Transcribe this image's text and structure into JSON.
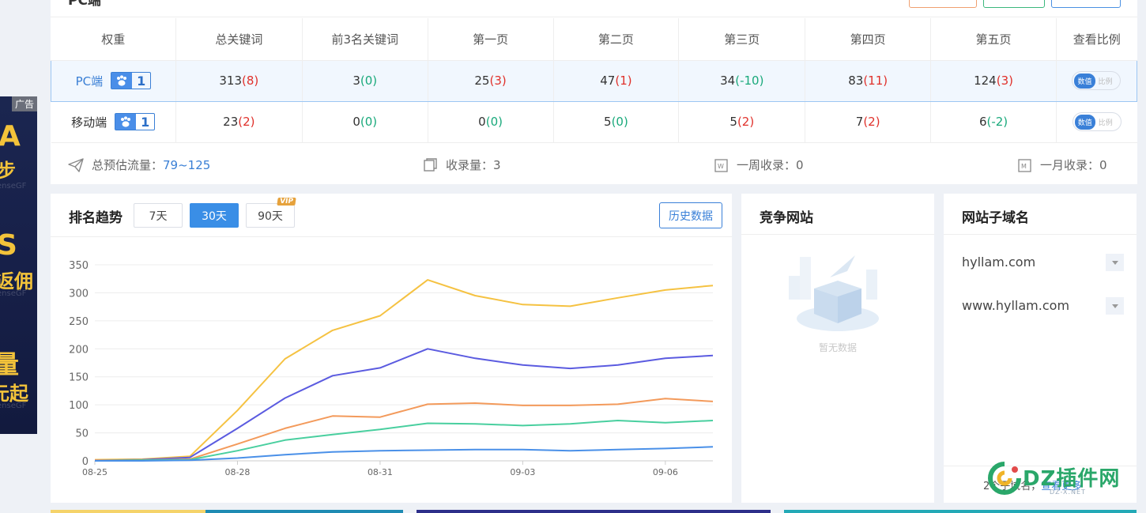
{
  "ad": {
    "tag": "广告",
    "lines": [
      "A",
      "步",
      "S",
      "返佣",
      "量",
      "元起"
    ],
    "ghost": "enseGF"
  },
  "top": {
    "title": "PC端",
    "columns": [
      "权重",
      "总关键词",
      "前3名关键词",
      "第一页",
      "第二页",
      "第三页",
      "第四页",
      "第五页",
      "查看比例"
    ],
    "rows": [
      {
        "label": "PC端",
        "badge": "1",
        "cells": [
          {
            "v": "313",
            "d": "(8)",
            "c": "red"
          },
          {
            "v": "3",
            "d": "(0)",
            "c": "green"
          },
          {
            "v": "25",
            "d": "(3)",
            "c": "red"
          },
          {
            "v": "47",
            "d": "(1)",
            "c": "red"
          },
          {
            "v": "34",
            "d": "(-10)",
            "c": "green"
          },
          {
            "v": "83",
            "d": "(11)",
            "c": "red"
          },
          {
            "v": "124",
            "d": "(3)",
            "c": "red"
          }
        ],
        "toggle_on": "数值",
        "toggle_off": "比例"
      },
      {
        "label": "移动端",
        "badge": "1",
        "cells": [
          {
            "v": "23",
            "d": "(2)",
            "c": "red"
          },
          {
            "v": "0",
            "d": "(0)",
            "c": "green"
          },
          {
            "v": "0",
            "d": "(0)",
            "c": "green"
          },
          {
            "v": "5",
            "d": "(0)",
            "c": "green"
          },
          {
            "v": "5",
            "d": "(2)",
            "c": "red"
          },
          {
            "v": "7",
            "d": "(2)",
            "c": "red"
          },
          {
            "v": "6",
            "d": "(-2)",
            "c": "green"
          }
        ],
        "toggle_on": "数值",
        "toggle_off": "比例"
      }
    ],
    "stats": {
      "traffic_label": "总预估流量：",
      "traffic_value": "79~125",
      "indexed_label": "收录量：",
      "indexed_value": "3",
      "week_label": "一周收录：",
      "week_value": "0",
      "month_label": "一月收录：",
      "month_value": "0"
    }
  },
  "trend": {
    "title": "排名趋势",
    "tabs": [
      "7天",
      "30天",
      "90天"
    ],
    "active_tab": "30天",
    "vip_badge": "VIP",
    "history_button": "历史数据"
  },
  "chart_data": {
    "type": "line",
    "x": [
      "08-25",
      "08-26",
      "08-27",
      "08-28",
      "08-29",
      "08-30",
      "08-31",
      "09-01",
      "09-02",
      "09-03",
      "09-04",
      "09-05",
      "09-06",
      "09-07"
    ],
    "tick_labels": [
      "08-25",
      "08-28",
      "08-31",
      "09-03",
      "09-06"
    ],
    "ylim": [
      0,
      350
    ],
    "yticks": [
      0,
      50,
      100,
      150,
      200,
      250,
      300,
      350
    ],
    "grid": true,
    "series": [
      {
        "color": "#f5c242",
        "values": [
          2,
          3,
          8,
          90,
          182,
          233,
          259,
          323,
          295,
          279,
          276,
          291,
          305,
          313
        ]
      },
      {
        "color": "#5b5be0",
        "values": [
          1,
          2,
          6,
          58,
          112,
          152,
          166,
          200,
          183,
          171,
          165,
          171,
          183,
          188
        ]
      },
      {
        "color": "#f39a5b",
        "values": [
          1,
          1,
          3,
          30,
          58,
          80,
          78,
          101,
          103,
          99,
          99,
          101,
          111,
          106
        ]
      },
      {
        "color": "#49cf9f",
        "values": [
          0,
          1,
          2,
          18,
          37,
          47,
          56,
          67,
          66,
          63,
          66,
          72,
          68,
          72
        ]
      },
      {
        "color": "#4a90e8",
        "values": [
          0,
          0,
          1,
          5,
          11,
          16,
          18,
          19,
          20,
          20,
          18,
          20,
          22,
          25
        ]
      }
    ]
  },
  "competitor": {
    "title": "竞争网站",
    "empty": "暂无数据"
  },
  "subdomains": {
    "title": "网站子域名",
    "items": [
      "hyllam.com",
      "www.hyllam.com"
    ],
    "footer_prefix": "2个子域名，",
    "footer_link": "查看更多"
  },
  "watermark": {
    "text": "DZ插件网",
    "sub": "DZ-X.NET"
  }
}
